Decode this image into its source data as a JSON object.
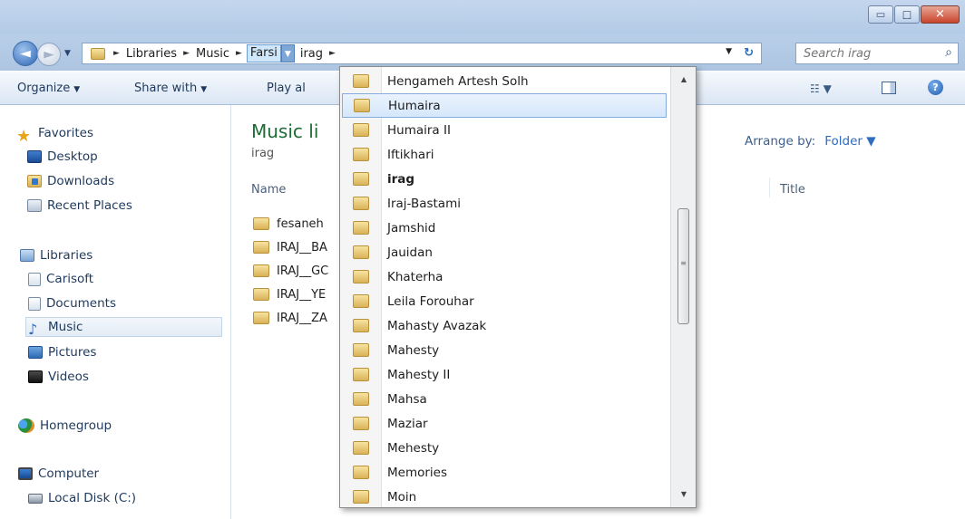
{
  "window": {
    "min_glyph": "▭",
    "max_glyph": "□",
    "close_glyph": "✕"
  },
  "nav": {
    "back_glyph": "◄",
    "forward_glyph": "►",
    "recent_glyph": "▼"
  },
  "address": {
    "crumbs": [
      "Libraries",
      "Music",
      "Farsi",
      "irag"
    ],
    "sep_glyph": "►",
    "dropdown_glyph": "▼",
    "refresh_glyph": "↻"
  },
  "search": {
    "placeholder": "Search irag",
    "icon_glyph": "⌕"
  },
  "toolbar": {
    "organize_label": "Organize",
    "share_label": "Share with",
    "play_label": "Play al",
    "caret": "▼",
    "views_glyph": "☷ ▼",
    "help_glyph": "?"
  },
  "sidebar": {
    "favorites": "Favorites",
    "desktop": "Desktop",
    "downloads": "Downloads",
    "recent_places": "Recent Places",
    "libraries": "Libraries",
    "carisoft": "Carisoft",
    "documents": "Documents",
    "music": "Music",
    "pictures": "Pictures",
    "videos": "Videos",
    "homegroup": "Homegroup",
    "computer": "Computer",
    "local_disk_c": "Local Disk (C:)",
    "star_glyph": "★",
    "music_glyph": "♪"
  },
  "content": {
    "library_title": "Music li",
    "library_subtitle": "irag",
    "arrange_label": "Arrange by:",
    "arrange_value": "Folder ▼",
    "col_name": "Name",
    "col_title": "Title",
    "files": [
      "fesaneh",
      "IRAJ__BA",
      "IRAJ__GC",
      "IRAJ__YE",
      "IRAJ__ZA"
    ]
  },
  "dropdown": {
    "items": [
      "Hengameh Artesh Solh",
      "Humaira",
      "Humaira II",
      "Iftikhari",
      "irag",
      "Iraj-Bastami",
      "Jamshid",
      "Jauidan",
      "Khaterha",
      "Leila Forouhar",
      "Mahasty Avazak",
      "Mahesty",
      "Mahesty II",
      "Mahsa",
      "Maziar",
      "Mehesty",
      "Memories",
      "Moin"
    ],
    "hover_index": 1,
    "current_index": 4,
    "scroll_up": "▲",
    "scroll_down": "▼",
    "grip": "≡"
  }
}
